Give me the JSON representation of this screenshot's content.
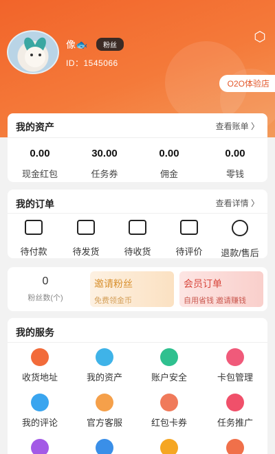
{
  "header": {
    "nickname": "像🐟",
    "badge": "粉丝",
    "user_id": "ID：1545066",
    "o2o_button": "O2O体验店"
  },
  "assets": {
    "title": "我的资产",
    "more": "查看账单 〉",
    "items": [
      {
        "value": "0.00",
        "label": "现金红包"
      },
      {
        "value": "30.00",
        "label": "任务券"
      },
      {
        "value": "0.00",
        "label": "佣金"
      },
      {
        "value": "0.00",
        "label": "零钱"
      }
    ]
  },
  "orders": {
    "title": "我的订单",
    "more": "查看详情 〉",
    "items": [
      {
        "label": "待付款",
        "icon": "wallet-icon"
      },
      {
        "label": "待发货",
        "icon": "package-icon"
      },
      {
        "label": "待收货",
        "icon": "receive-box-icon"
      },
      {
        "label": "待评价",
        "icon": "edit-icon"
      },
      {
        "label": "退款/售后",
        "icon": "refund-icon"
      }
    ]
  },
  "promo": {
    "fans_count": "0",
    "fans_label": "粉丝数(个)",
    "invite_title": "邀请粉丝",
    "invite_sub": "免费领金币",
    "member_title": "会员订单",
    "member_sub": "自用省钱 邀请赚钱"
  },
  "services": {
    "title": "我的服务",
    "items": [
      {
        "label": "收货地址",
        "icon": "location-icon",
        "color": "#f26b3a"
      },
      {
        "label": "我的资产",
        "icon": "money-bag-icon",
        "color": "#3fb3e8"
      },
      {
        "label": "账户安全",
        "icon": "shield-icon",
        "color": "#2fc08f"
      },
      {
        "label": "卡包管理",
        "icon": "card-wallet-icon",
        "color": "#f05a7a"
      },
      {
        "label": "我的评论",
        "icon": "chat-icon",
        "color": "#3aa5ef"
      },
      {
        "label": "官方客服",
        "icon": "customer-service-icon",
        "color": "#f5a04a"
      },
      {
        "label": "红包卡券",
        "icon": "red-packet-icon",
        "color": "#f07a5a"
      },
      {
        "label": "任务推广",
        "icon": "diamond-icon",
        "color": "#f0506a"
      },
      {
        "label": "",
        "icon": "history-icon",
        "color": "#a35ae6"
      },
      {
        "label": "",
        "icon": "clock-icon",
        "color": "#3a8fe8"
      },
      {
        "label": "",
        "icon": "star-icon",
        "color": "#f5a623"
      },
      {
        "label": "",
        "icon": "mail-icon",
        "color": "#f0704a"
      }
    ]
  }
}
